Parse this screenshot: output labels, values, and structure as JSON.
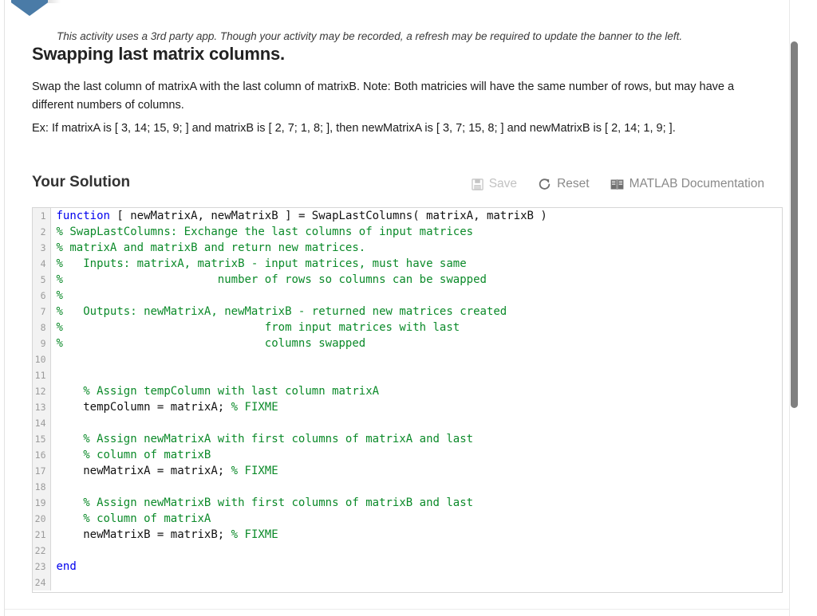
{
  "banner": {
    "icon": "bookmark-banner",
    "color": "#4a7ba7"
  },
  "notice": {
    "text": "This activity uses a 3rd party app. Though your activity may be recorded, a refresh may be required to update the banner to the left."
  },
  "page": {
    "title": "Swapping last matrix columns.",
    "paragraph_1": "Swap the last column of matrixA with the last column of matrixB. Note: Both matricies will have the same number of rows, but may have a different numbers of columns.",
    "paragraph_2": "Ex: If matrixA is [ 3, 14; 15, 9; ] and matrixB is [ 2, 7; 1, 8; ], then newMatrixA is [ 3, 7; 15, 8; ] and newMatrixB is [ 2, 14; 1, 9; ]."
  },
  "solution": {
    "heading": "Your Solution",
    "toolbar": {
      "save_label": "Save",
      "save_icon": "floppy-disk-icon",
      "save_enabled": false,
      "reset_label": "Reset",
      "reset_icon": "refresh-circular-arrow-icon",
      "docs_label": "MATLAB Documentation",
      "docs_icon": "book-icon"
    }
  },
  "editor": {
    "language": "matlab",
    "total_lines": 24,
    "lines": [
      {
        "n": 1,
        "tokens": [
          {
            "t": "kw",
            "s": "function"
          },
          {
            "t": "pl",
            "s": " [ newMatrixA, newMatrixB ] = SwapLastColumns( matrixA, matrixB )"
          }
        ]
      },
      {
        "n": 2,
        "tokens": [
          {
            "t": "cm",
            "s": "% SwapLastColumns: Exchange the last columns of input matrices"
          }
        ]
      },
      {
        "n": 3,
        "tokens": [
          {
            "t": "cm",
            "s": "% matrixA and matrixB and return new matrices."
          }
        ]
      },
      {
        "n": 4,
        "tokens": [
          {
            "t": "cm",
            "s": "%   Inputs: matrixA, matrixB - input matrices, must have same"
          }
        ]
      },
      {
        "n": 5,
        "tokens": [
          {
            "t": "cm",
            "s": "%                       number of rows so columns can be swapped"
          }
        ]
      },
      {
        "n": 6,
        "tokens": [
          {
            "t": "cm",
            "s": "%"
          }
        ]
      },
      {
        "n": 7,
        "tokens": [
          {
            "t": "cm",
            "s": "%   Outputs: newMatrixA, newMatrixB - returned new matrices created"
          }
        ]
      },
      {
        "n": 8,
        "tokens": [
          {
            "t": "cm",
            "s": "%                              from input matrices with last"
          }
        ]
      },
      {
        "n": 9,
        "tokens": [
          {
            "t": "cm",
            "s": "%                              columns swapped"
          }
        ]
      },
      {
        "n": 10,
        "tokens": [
          {
            "t": "pl",
            "s": ""
          }
        ]
      },
      {
        "n": 11,
        "tokens": [
          {
            "t": "pl",
            "s": ""
          }
        ]
      },
      {
        "n": 12,
        "tokens": [
          {
            "t": "cm",
            "s": "    % Assign tempColumn with last column matrixA"
          }
        ]
      },
      {
        "n": 13,
        "tokens": [
          {
            "t": "pl",
            "s": "    tempColumn = matrixA; "
          },
          {
            "t": "cm",
            "s": "% FIXME"
          }
        ]
      },
      {
        "n": 14,
        "tokens": [
          {
            "t": "pl",
            "s": ""
          }
        ]
      },
      {
        "n": 15,
        "tokens": [
          {
            "t": "cm",
            "s": "    % Assign newMatrixA with first columns of matrixA and last"
          }
        ]
      },
      {
        "n": 16,
        "tokens": [
          {
            "t": "cm",
            "s": "    % column of matrixB"
          }
        ]
      },
      {
        "n": 17,
        "tokens": [
          {
            "t": "pl",
            "s": "    newMatrixA = matrixA; "
          },
          {
            "t": "cm",
            "s": "% FIXME"
          }
        ]
      },
      {
        "n": 18,
        "tokens": [
          {
            "t": "pl",
            "s": ""
          }
        ]
      },
      {
        "n": 19,
        "tokens": [
          {
            "t": "cm",
            "s": "    % Assign newMatrixB with first columns of matrixB and last"
          }
        ]
      },
      {
        "n": 20,
        "tokens": [
          {
            "t": "cm",
            "s": "    % column of matrixA"
          }
        ]
      },
      {
        "n": 21,
        "tokens": [
          {
            "t": "pl",
            "s": "    newMatrixB = matrixB; "
          },
          {
            "t": "cm",
            "s": "% FIXME"
          }
        ]
      },
      {
        "n": 22,
        "tokens": [
          {
            "t": "pl",
            "s": ""
          }
        ]
      },
      {
        "n": 23,
        "tokens": [
          {
            "t": "kw",
            "s": "end"
          }
        ]
      },
      {
        "n": 24,
        "tokens": [
          {
            "t": "pl",
            "s": ""
          }
        ]
      }
    ],
    "colors": {
      "keyword": "#0000ee",
      "comment": "#0b8a29",
      "plain": "#111111"
    }
  },
  "scrollbar": {
    "name": "page-scrollbar"
  }
}
